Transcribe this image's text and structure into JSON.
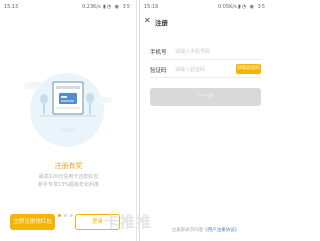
{
  "left": {
    "status": {
      "time": "15:15",
      "speed": "0.23K/s",
      "icons": "▮◔ ◉ 35"
    },
    "promo": {
      "title": "注册有奖",
      "line1": "最高120元信用卡还款红包",
      "line2": "新手专享13%超级年化利率"
    },
    "buttons": {
      "register": "立即注册领红包",
      "login": "登录"
    }
  },
  "right": {
    "status": {
      "time": "15:16",
      "speed": "0.05K/s",
      "icons": "▮◔ ◉ 35"
    },
    "nav": {
      "back_icon": "✕",
      "title": "注册"
    },
    "form": {
      "phone_label": "手机号",
      "phone_placeholder": "请输入手机号码",
      "code_label": "验证码",
      "code_placeholder": "请输入验证码",
      "get_code": "获取验证码"
    },
    "next": "下一步",
    "agreement": {
      "text": "注册即表示同意",
      "link": "《用户注册协议》"
    }
  },
  "watermark": "卡推推",
  "colors": {
    "accent": "#f5b400",
    "promo_title": "#f3a21a",
    "disabled": "#d9d9d9"
  }
}
